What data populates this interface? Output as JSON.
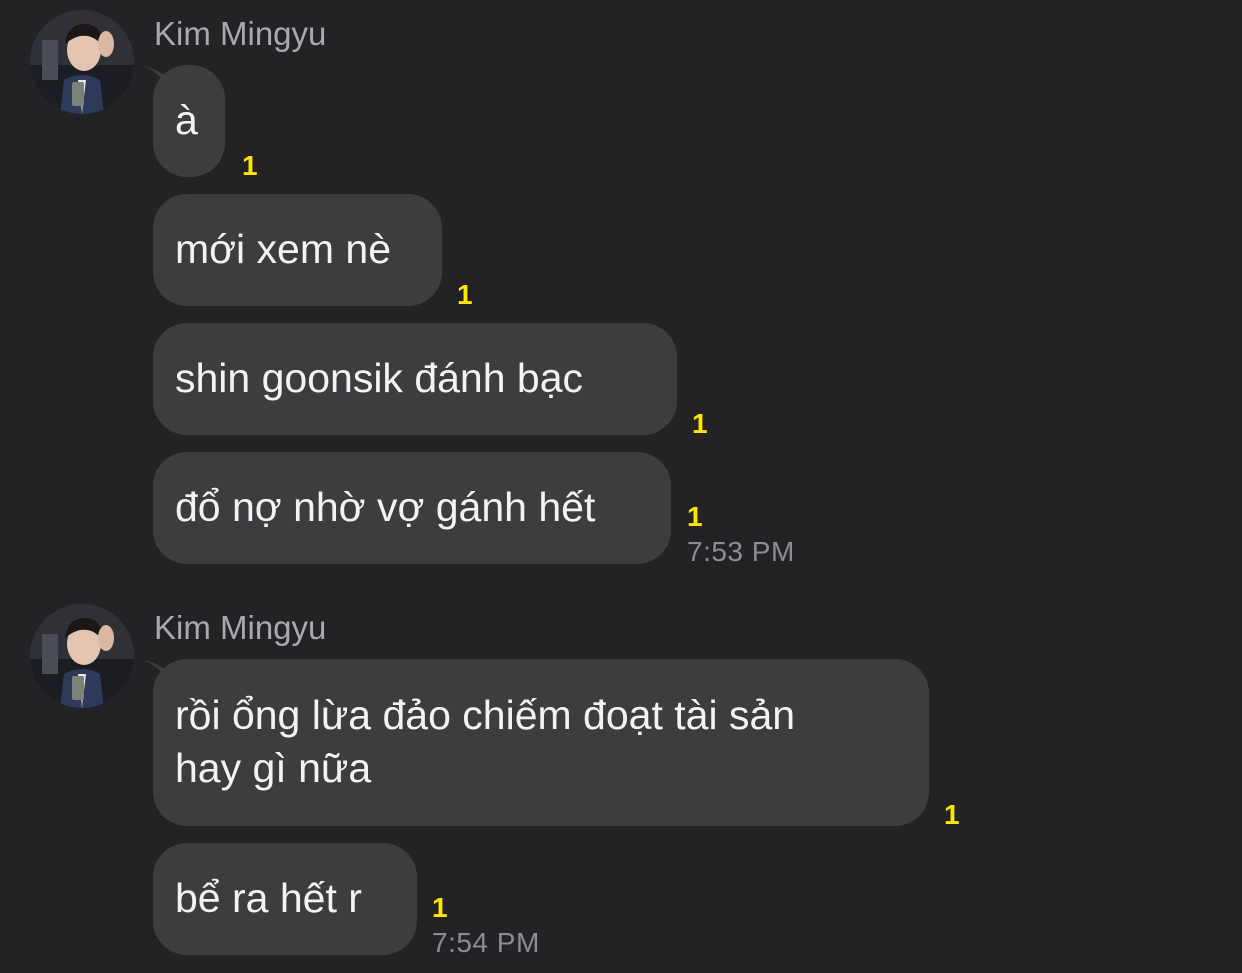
{
  "groups": [
    {
      "sender": "Kim Mingyu",
      "messages": [
        {
          "text": "à",
          "unread": "1"
        },
        {
          "text": "mới xem nè",
          "unread": "1"
        },
        {
          "text": "shin goonsik đánh bạc",
          "unread": "1"
        },
        {
          "text": "đổ nợ nhờ vợ gánh hết",
          "unread": "1",
          "time": "7:53 PM"
        }
      ]
    },
    {
      "sender": "Kim Mingyu",
      "messages": [
        {
          "lines": [
            "rồi ổng lừa đảo chiếm đoạt tài sản",
            "hay gì nữa"
          ],
          "unread": "1"
        },
        {
          "text": "bể ra hết r",
          "unread": "1",
          "time": "7:54 PM"
        }
      ]
    }
  ],
  "colors": {
    "background": "#232325",
    "bubble": "#3d3d40",
    "unread": "#ffe600",
    "sender": "#a9a9ad",
    "time": "#8d8d91"
  }
}
